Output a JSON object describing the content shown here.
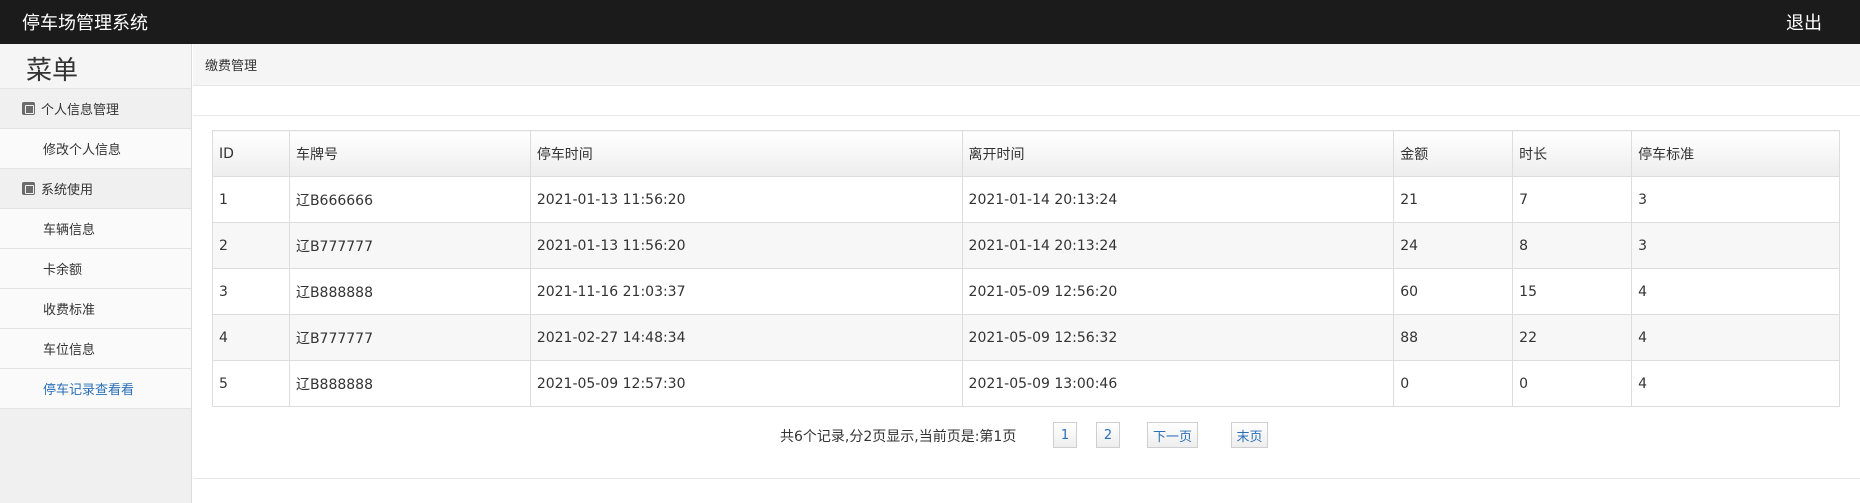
{
  "header": {
    "title": "停车场管理系统",
    "logout_label": "退出"
  },
  "sidebar": {
    "menu_title": "菜单",
    "groups": [
      {
        "label": "个人信息管理",
        "items": [
          "修改个人信息"
        ]
      },
      {
        "label": "系统使用",
        "items": [
          "车辆信息",
          "卡余额",
          "收费标准",
          "车位信息",
          "停车记录查看看"
        ]
      }
    ],
    "active_item": "停车记录查看看"
  },
  "breadcrumb": "缴费管理",
  "table": {
    "columns": [
      "ID",
      "车牌号",
      "停车时间",
      "离开时间",
      "金额",
      "时长",
      "停车标准"
    ],
    "rows": [
      [
        "1",
        "辽B666666",
        "2021-01-13 11:56:20",
        "2021-01-14 20:13:24",
        "21",
        "7",
        "3"
      ],
      [
        "2",
        "辽B777777",
        "2021-01-13 11:56:20",
        "2021-01-14 20:13:24",
        "24",
        "8",
        "3"
      ],
      [
        "3",
        "辽B888888",
        "2021-11-16 21:03:37",
        "2021-05-09 12:56:20",
        "60",
        "15",
        "4"
      ],
      [
        "4",
        "辽B777777",
        "2021-02-27 14:48:34",
        "2021-05-09 12:56:32",
        "88",
        "22",
        "4"
      ],
      [
        "5",
        "辽B888888",
        "2021-05-09 12:57:30",
        "2021-05-09 13:00:46",
        "0",
        "0",
        "4"
      ]
    ]
  },
  "pagination": {
    "info": "共6个记录,分2页显示,当前页是:第1页",
    "page1": "1",
    "page2": "2",
    "next": "下一页",
    "last": "末页"
  }
}
